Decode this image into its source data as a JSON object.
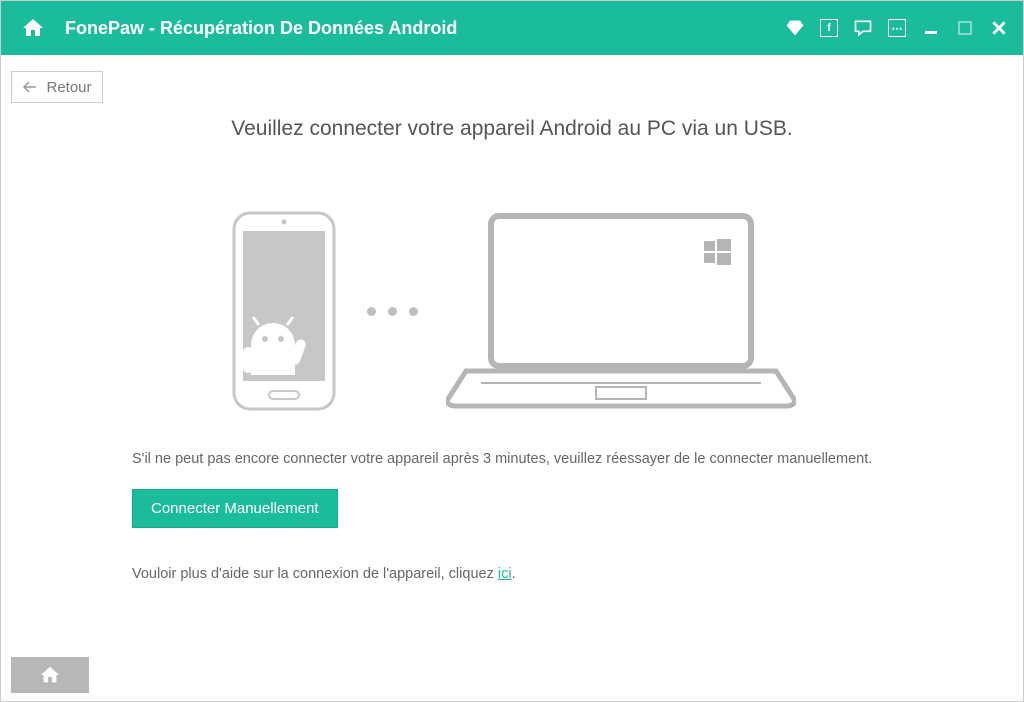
{
  "titlebar": {
    "app_title": "FonePaw - Récupération De Données Android"
  },
  "back_button": {
    "label": "Retour"
  },
  "main": {
    "heading": "Veuillez connecter votre appareil Android au PC via un USB.",
    "instruction": "S'il ne peut pas encore connecter votre appareil après 3 minutes, veuillez réessayer de le connecter manuellement.",
    "connect_button": "Connecter Manuellement",
    "help_prefix": "Vouloir plus d'aide sur la connexion de l'appareil, cliquez ",
    "help_link": "ici",
    "help_suffix": "."
  }
}
